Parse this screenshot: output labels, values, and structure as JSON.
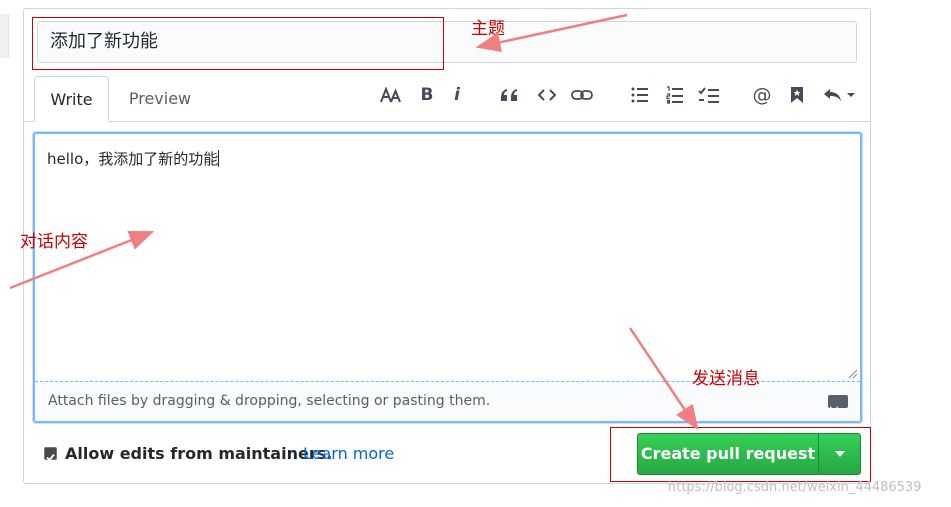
{
  "title_input": {
    "value": "添加了新功能"
  },
  "tabs": [
    {
      "label": "Write",
      "active": true
    },
    {
      "label": "Preview",
      "active": false
    }
  ],
  "toolbar": {
    "icons": [
      "text-size-icon",
      "bold-icon",
      "italic-icon",
      "quote-icon",
      "code-icon",
      "link-icon",
      "bullet-list-icon",
      "numbered-list-icon",
      "task-list-icon",
      "mention-icon",
      "bookmark-icon",
      "reply-icon"
    ],
    "bold_glyph": "B",
    "italic_glyph": "i",
    "mention_glyph": "@"
  },
  "editor": {
    "value": "hello，我添加了新的功能",
    "attach_hint": "Attach files by dragging & dropping, selecting or pasting them."
  },
  "maintainers": {
    "checked": true,
    "label": "Allow edits from maintainers.",
    "link": "Learn more"
  },
  "submit": {
    "label": "Create pull request"
  },
  "annotations": {
    "subject": "主题",
    "content": "对话内容",
    "send": "发送消息"
  },
  "watermark": "https://blog.csdn.net/weixin_44486539",
  "colors": {
    "accent": "#2ea44f",
    "link": "#0366d6",
    "annotation": "#cc0000",
    "arrow": "#f08080"
  }
}
